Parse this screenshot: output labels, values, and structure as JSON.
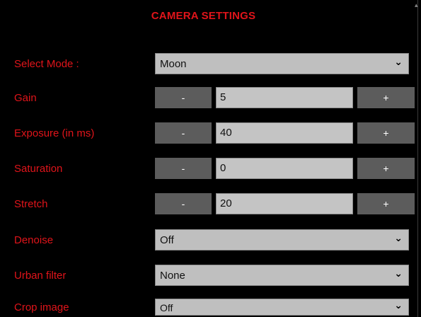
{
  "title": "CAMERA SETTINGS",
  "rows": {
    "mode": {
      "label": "Select Mode :",
      "value": "Moon"
    },
    "gain": {
      "label": "Gain",
      "value": "5",
      "minus": "-",
      "plus": "+"
    },
    "exposure": {
      "label": "Exposure (in ms)",
      "value": "40",
      "minus": "-",
      "plus": "+"
    },
    "saturation": {
      "label": "Saturation",
      "value": "0",
      "minus": "-",
      "plus": "+"
    },
    "stretch": {
      "label": "Stretch",
      "value": "20",
      "minus": "-",
      "plus": "+"
    },
    "denoise": {
      "label": "Denoise",
      "value": "Off"
    },
    "urban": {
      "label": "Urban filter",
      "value": "None"
    },
    "crop": {
      "label": "Crop image",
      "value": "Off"
    }
  },
  "icons": {
    "dropdown": "chevron-down-icon"
  },
  "colors": {
    "label": "#e0141a",
    "button": "#5c5c5c",
    "field": "#c4c4c4",
    "background": "#000000"
  }
}
